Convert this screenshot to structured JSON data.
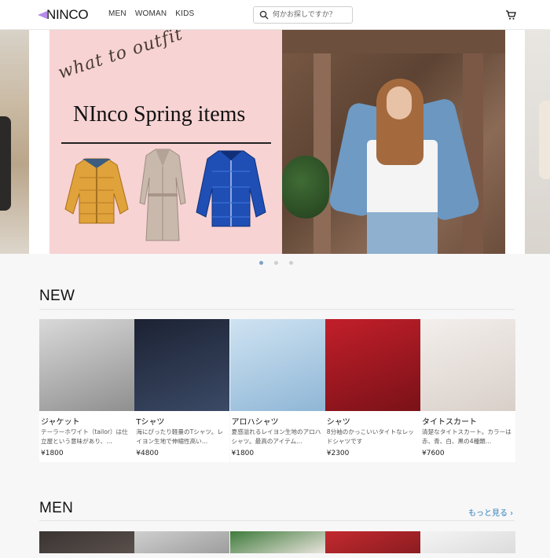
{
  "header": {
    "logo": "NINCO",
    "nav": [
      "MEN",
      "WOMAN",
      "KIDS"
    ],
    "search_placeholder": "何かお探しですか？"
  },
  "hero": {
    "script_text": "what to outfit",
    "title": "NInco Spring items",
    "slide_count": 3,
    "active_slide": 1
  },
  "new_section": {
    "title": "NEW",
    "products": [
      {
        "name": "ジャケット",
        "desc": "テーラーホワイト（tailor）は仕立屋という意味があり、…",
        "price": "¥1800",
        "img": [
          "#d9d9d9",
          "#8f8f8f"
        ]
      },
      {
        "name": "Tシャツ",
        "desc": "海にぴったり軽量のTシャツ。レイヨン生地で伸縮性高い…",
        "price": "¥4800",
        "img": [
          "#1c2233",
          "#3b4a66"
        ]
      },
      {
        "name": "アロハシャツ",
        "desc": "夏感溢れるレイヨン生地のアロハシャツ。最高のアイテム…",
        "price": "¥1800",
        "img": [
          "#cfe3f2",
          "#8fb6d6"
        ]
      },
      {
        "name": "シャツ",
        "desc": "8分袖のかっこいいタイトなレッドシャツです",
        "price": "¥2300",
        "img": [
          "#c21f2a",
          "#7a1118"
        ]
      },
      {
        "name": "タイトスカート",
        "desc": "清楚なタイトスカート。カラーは赤、青、白、黒の4種類…",
        "price": "¥7600",
        "img": [
          "#f3efec",
          "#d9cfc9"
        ]
      }
    ]
  },
  "men_section": {
    "title": "MEN",
    "more_label": "もっと見る ›",
    "products": [
      {
        "img": [
          "#3a3432",
          "#5a504c"
        ]
      },
      {
        "img": [
          "#cfcfcf",
          "#9d9d9d"
        ]
      },
      {
        "img": [
          "#3f7b3c",
          "#e9e3dc"
        ]
      },
      {
        "img": [
          "#c32a2f",
          "#8a1c20"
        ]
      },
      {
        "img": [
          "#f4f4f4",
          "#dcdcdc"
        ]
      }
    ]
  }
}
